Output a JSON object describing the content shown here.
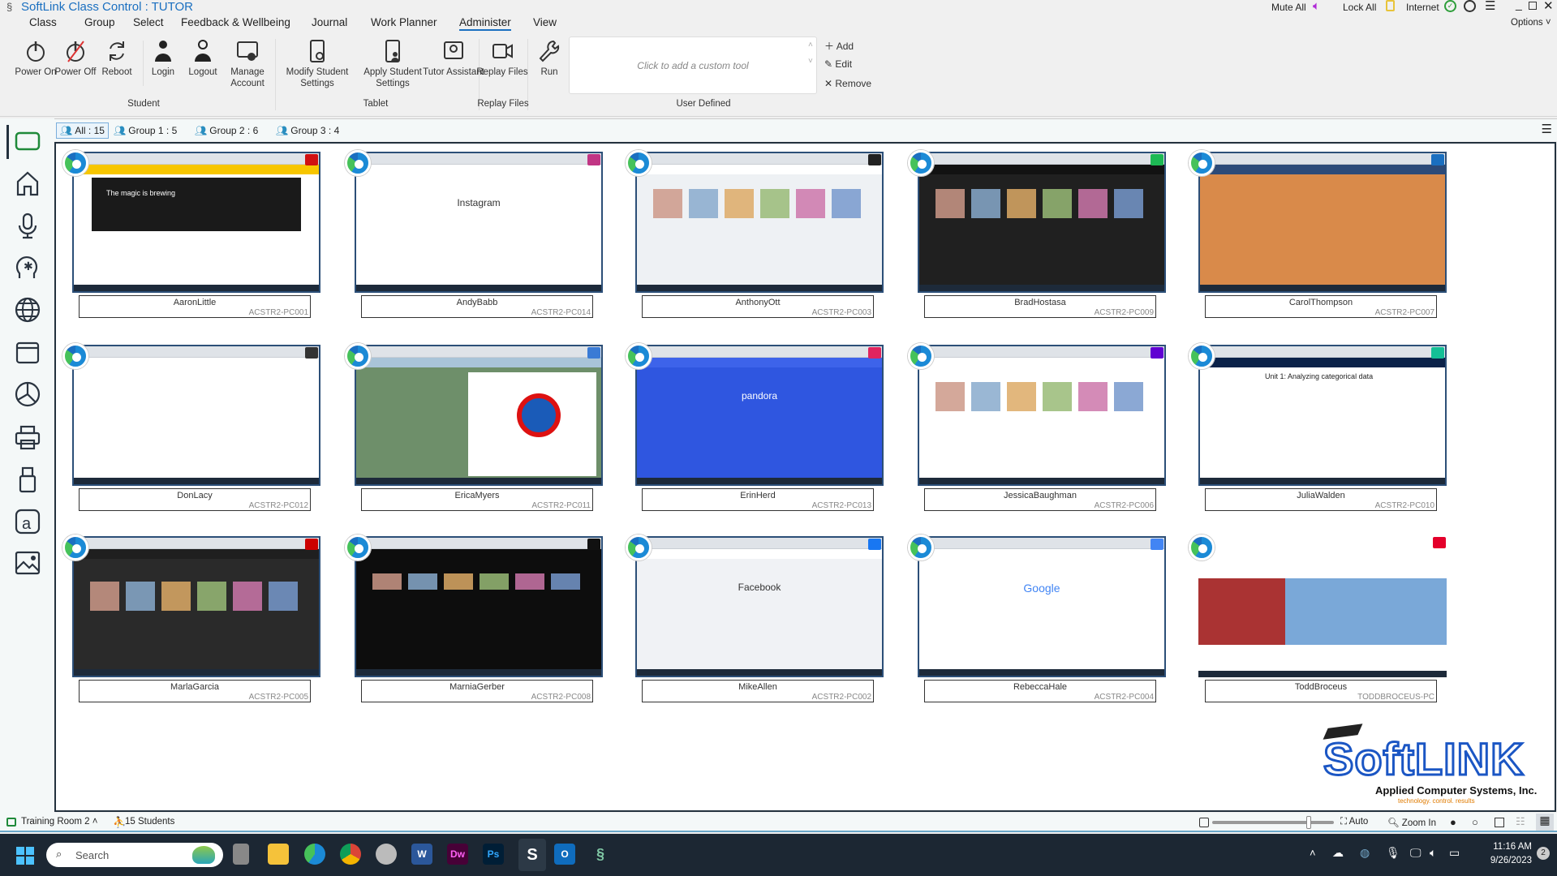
{
  "window": {
    "title": "SoftLink Class Control : TUTOR"
  },
  "top_right": {
    "mute_all": "Mute All",
    "lock_all": "Lock All",
    "internet": "Internet",
    "options": "Options"
  },
  "menu": [
    "Class",
    "Group",
    "Select",
    "Feedback & Wellbeing",
    "Journal",
    "Work Planner",
    "Administer",
    "View"
  ],
  "menu_active": "Administer",
  "ribbon": {
    "buttons": [
      {
        "label": "Power On",
        "icon": "power-icon"
      },
      {
        "label": "Power Off",
        "icon": "power-off-icon"
      },
      {
        "label": "Reboot",
        "icon": "reboot-icon"
      },
      {
        "label": "Login",
        "icon": "login-icon"
      },
      {
        "label": "Logout",
        "icon": "logout-icon"
      },
      {
        "label": "Manage Account",
        "icon": "manage-account-icon"
      },
      {
        "label": "Modify Student Settings",
        "icon": "tablet-settings-icon"
      },
      {
        "label": "Apply Student Settings",
        "icon": "tablet-user-icon"
      },
      {
        "label": "Tutor Assistant",
        "icon": "tutor-assistant-icon"
      },
      {
        "label": "Replay Files",
        "icon": "video-icon"
      },
      {
        "label": "Run",
        "icon": "wrench-icon"
      }
    ],
    "groups": [
      "Student",
      "Tablet",
      "Replay Files",
      "User Defined"
    ],
    "custom_tool_placeholder": "Click to add a custom tool",
    "user_defined": {
      "add": "Add",
      "edit": "Edit",
      "remove": "Remove"
    }
  },
  "group_tabs": [
    {
      "label": "All : 15",
      "active": true
    },
    {
      "label": "Group 1 : 5"
    },
    {
      "label": "Group 2 : 6"
    },
    {
      "label": "Group 3 : 4"
    }
  ],
  "sidebar": [
    "monitor-icon",
    "home-icon",
    "microphone-icon",
    "wellbeing-icon",
    "globe-icon",
    "window-icon",
    "pie-chart-icon",
    "printer-icon",
    "usb-icon",
    "text-box-icon",
    "image-icon"
  ],
  "students": [
    {
      "name": "AaronLittle",
      "pc": "ACSTR2-PC001",
      "bg": "#1a1a1a",
      "head": "#f7c600",
      "site": "#d01012",
      "caption": "The magic is brewing"
    },
    {
      "name": "AndyBabb",
      "pc": "ACSTR2-PC014",
      "bg": "#ffffff",
      "head": "#ffffff",
      "site": "#c13584",
      "caption": "Instagram"
    },
    {
      "name": "AnthonyOtt",
      "pc": "ACSTR2-PC003",
      "bg": "#eef1f4",
      "head": "#ffffff",
      "site": "#222222",
      "caption": ""
    },
    {
      "name": "BradHostasa",
      "pc": "ACSTR2-PC009",
      "bg": "#202020",
      "head": "#121212",
      "site": "#1db954",
      "caption": ""
    },
    {
      "name": "CarolThompson",
      "pc": "ACSTR2-PC007",
      "bg": "#d98a4a",
      "head": "#2c4a78",
      "site": "#1a6fc0",
      "caption": ""
    },
    {
      "name": "DonLacy",
      "pc": "ACSTR2-PC012",
      "bg": "#ffffff",
      "head": "#ffffff",
      "site": "#333333",
      "caption": ""
    },
    {
      "name": "EricaMyers",
      "pc": "ACSTR2-PC011",
      "bg": "#6e8f6a",
      "head": "#a9c4d8",
      "site": "#3a7bd5",
      "caption": ""
    },
    {
      "name": "ErinHerd",
      "pc": "ACSTR2-PC013",
      "bg": "#2f56e0",
      "head": "#3d63ea",
      "site": "#e0245e",
      "caption": "pandora"
    },
    {
      "name": "JessicaBaughman",
      "pc": "ACSTR2-PC006",
      "bg": "#ffffff",
      "head": "#ffffff",
      "site": "#6001d2",
      "caption": ""
    },
    {
      "name": "JuliaWalden",
      "pc": "ACSTR2-PC010",
      "bg": "#ffffff",
      "head": "#0b2249",
      "site": "#14bf96",
      "caption": "Unit 1: Analyzing categorical data"
    },
    {
      "name": "MarlaGarcia",
      "pc": "ACSTR2-PC005",
      "bg": "#2a2a2a",
      "head": "#1f1f1f",
      "site": "#cc0000",
      "caption": ""
    },
    {
      "name": "MarniaGerber",
      "pc": "ACSTR2-PC008",
      "bg": "#0d0d0d",
      "head": "#0d0d0d",
      "site": "#111111",
      "caption": ""
    },
    {
      "name": "MikeAllen",
      "pc": "ACSTR2-PC002",
      "bg": "#f0f2f5",
      "head": "#ffffff",
      "site": "#1877f2",
      "caption": "Facebook"
    },
    {
      "name": "RebeccaHale",
      "pc": "ACSTR2-PC004",
      "bg": "#ffffff",
      "head": "#ffffff",
      "site": "#4285f4",
      "caption": "Google"
    },
    {
      "name": "ToddBroceus",
      "pc": "TODDBROCEUS-PC",
      "bg": "#ffffff",
      "head": "#ffffff",
      "site": "#e4002b",
      "caption": ""
    }
  ],
  "logo": {
    "brand": "SoftLINK",
    "company": "Applied Computer Systems, Inc.",
    "tagline": "technology. control. results"
  },
  "status_bar": {
    "room": "Training Room 2",
    "students": "15 Students",
    "auto": "Auto",
    "zoom_in": "Zoom In"
  },
  "taskbar": {
    "search": "Search",
    "time": "11:16 AM",
    "date": "9/26/2023",
    "notifications": "2"
  },
  "colors": {
    "accent": "#1a6fc0",
    "thumb_border": "#2c4f78",
    "taskbar": "#1c2733"
  }
}
